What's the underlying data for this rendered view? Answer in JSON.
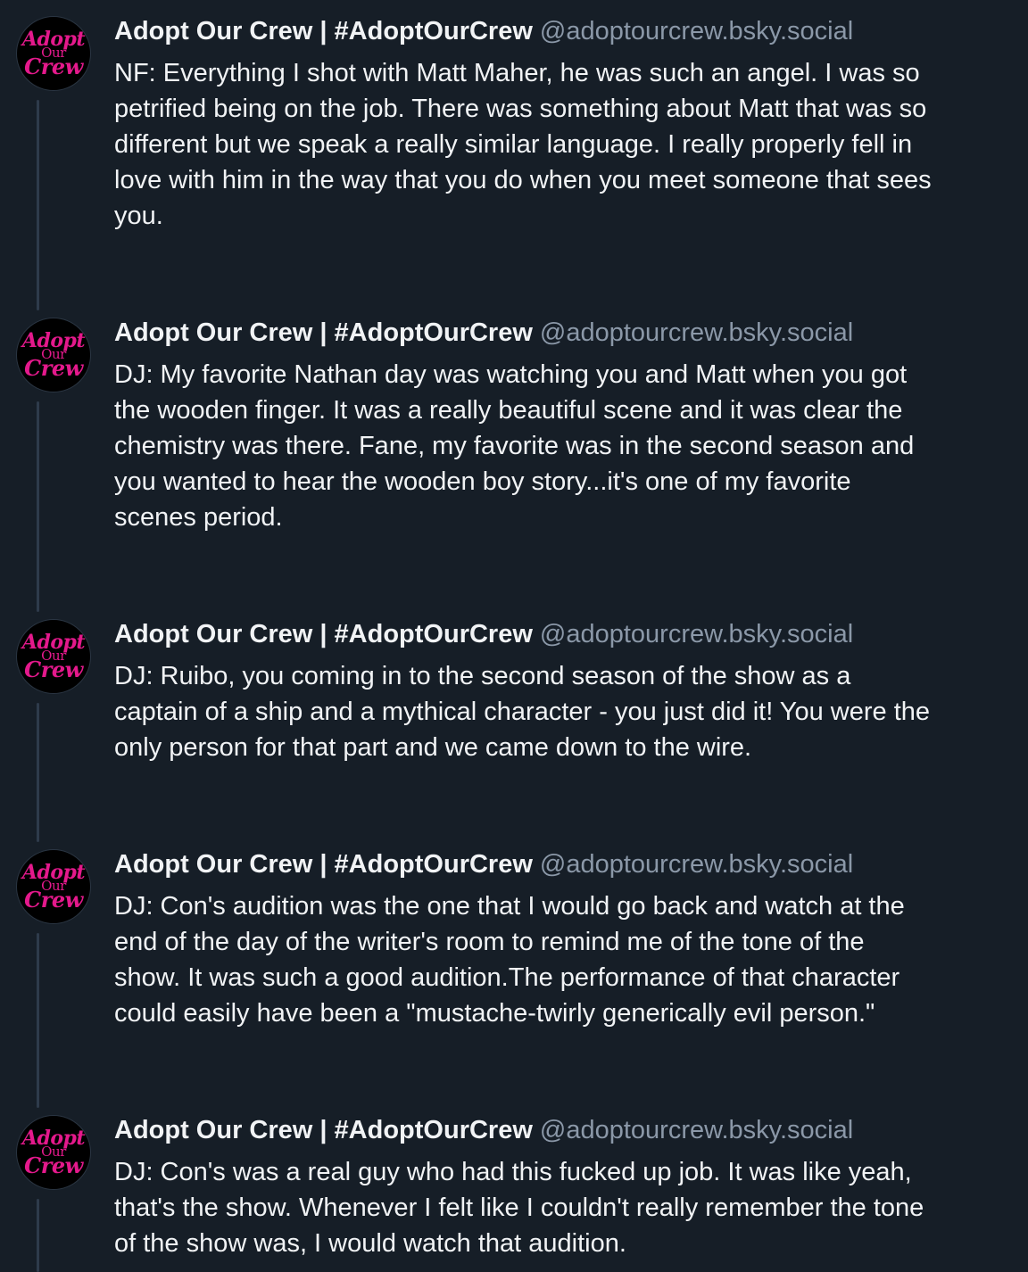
{
  "posts": [
    {
      "author": "Adopt Our Crew | #AdoptOurCrew",
      "handle": "@adoptourcrew.bsky.social",
      "avatar_text": [
        "Adopt",
        "Our",
        "Crew"
      ],
      "text": "NF: Everything I shot with Matt Maher, he was such an angel. I was so\npetrified being on the job. There was something about Matt that was so\ndifferent but we speak a really similar language. I really properly fell in\nlove with him in the way that you do when you meet someone that sees\nyou."
    },
    {
      "author": "Adopt Our Crew | #AdoptOurCrew",
      "handle": "@adoptourcrew.bsky.social",
      "avatar_text": [
        "Adopt",
        "Our",
        "Crew"
      ],
      "text": "DJ: My favorite Nathan day was watching you and Matt when you got\nthe wooden finger. It was a really beautiful scene and it was clear the\nchemistry was there. Fane, my favorite was in the second season and\nyou wanted to hear the wooden boy story...it's one of my favorite\nscenes period."
    },
    {
      "author": "Adopt Our Crew | #AdoptOurCrew",
      "handle": "@adoptourcrew.bsky.social",
      "avatar_text": [
        "Adopt",
        "Our",
        "Crew"
      ],
      "text": "DJ: Ruibo, you coming in to the second season of the show as a\ncaptain of a ship and a mythical character - you just did it! You were the\nonly person for that part and we came down to the wire."
    },
    {
      "author": "Adopt Our Crew | #AdoptOurCrew",
      "handle": "@adoptourcrew.bsky.social",
      "avatar_text": [
        "Adopt",
        "Our",
        "Crew"
      ],
      "text": "DJ: Con's audition was the one that I would go back and watch at the\nend of the day of the writer's room to remind me of the tone of the\nshow. It was such a good audition.The performance of that character\ncould easily have been a \"mustache-twirly generically evil person.\""
    },
    {
      "author": "Adopt Our Crew | #AdoptOurCrew",
      "handle": "@adoptourcrew.bsky.social",
      "avatar_text": [
        "Adopt",
        "Our",
        "Crew"
      ],
      "text": "DJ: Con's was a real guy who had this fucked up job. It was like yeah,\nthat's the show. Whenever I felt like I couldn't really remember the tone\nof the show was, I would watch that audition."
    }
  ],
  "colors": {
    "background": "#161e27",
    "text": "#f1f3f5",
    "handle": "#8b98a8",
    "thread_line": "#2e3b4b",
    "logo_pink": "#e4198c"
  }
}
